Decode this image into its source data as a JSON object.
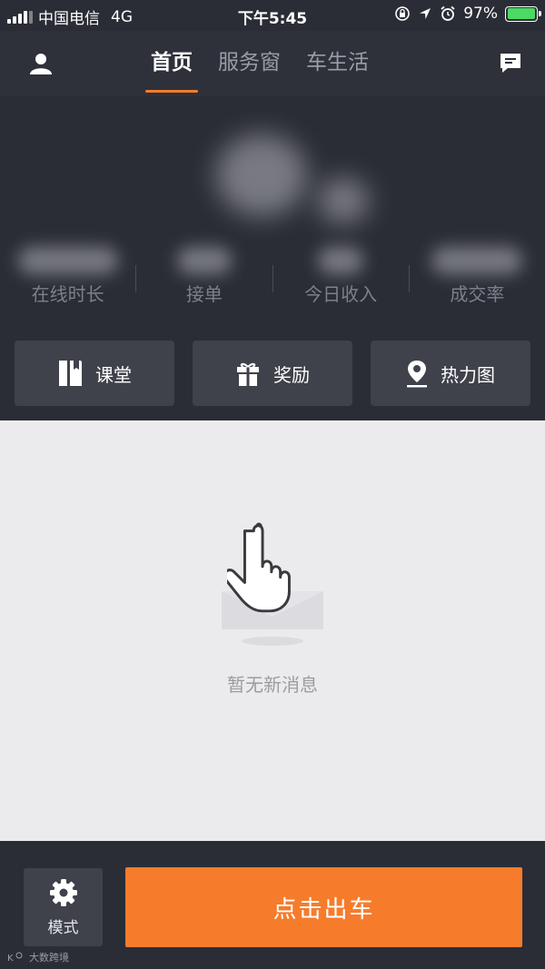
{
  "status_bar": {
    "carrier": "中国电信",
    "network": "4G",
    "time": "下午5:45",
    "battery_percent": "97%",
    "battery_level": 0.97
  },
  "header": {
    "tabs": [
      {
        "label": "首页",
        "active": true
      },
      {
        "label": "服务窗",
        "active": false
      },
      {
        "label": "车生活",
        "active": false
      }
    ],
    "icons": [
      "user-icon",
      "message-icon"
    ]
  },
  "stats": [
    {
      "label": "在线时长"
    },
    {
      "label": "接单"
    },
    {
      "label": "今日收入"
    },
    {
      "label": "成交率"
    }
  ],
  "actions": [
    {
      "label": "课堂",
      "icon": "book-icon"
    },
    {
      "label": "奖励",
      "icon": "gift-icon"
    },
    {
      "label": "热力图",
      "icon": "map-pin-icon"
    }
  ],
  "empty_state": {
    "message": "暂无新消息",
    "icon": "hand-pointer-icon"
  },
  "footer": {
    "mode_label": "模式",
    "mode_icon": "gear-icon",
    "start_label": "点击出车",
    "watermark": "大数跨境"
  },
  "colors": {
    "accent": "#f67c2c",
    "background_dark": "#2b2d36",
    "button_dark": "#3f414b",
    "content_bg": "#ebebed"
  }
}
